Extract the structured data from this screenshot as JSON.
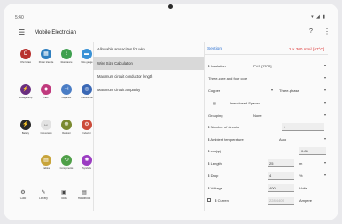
{
  "status": {
    "time": "5:40",
    "icons": "▾ ◢ ▮"
  },
  "app": {
    "title": "Mobile Electrician",
    "menu_icon": "☰",
    "help_icon": "?",
    "more_icon": "⋮"
  },
  "tiles": [
    {
      "name": "tile-ohm",
      "label": "Ohm's law",
      "color": "#b8322f",
      "glyph": "Ω"
    },
    {
      "name": "tile-power",
      "label": "Power triangle",
      "color": "#2f7fbf",
      "glyph": "▦"
    },
    {
      "name": "tile-resistance",
      "label": "Resistance",
      "color": "#3fa04f",
      "glyph": "⌇"
    },
    {
      "name": "tile-wire-gauge",
      "label": "Wire gauge",
      "color": "#3a92d6",
      "glyph": "▬"
    },
    {
      "name": "tile-voltage-drop",
      "label": "Voltage drop",
      "color": "#6a2f80",
      "glyph": "⚡"
    },
    {
      "name": "tile-led",
      "label": "LED",
      "color": "#c03a7e",
      "glyph": "◆"
    },
    {
      "name": "tile-capacitor",
      "label": "Capacitor",
      "color": "#4a7dc5",
      "glyph": "⊣"
    },
    {
      "name": "tile-transformer",
      "label": "Transformer",
      "color": "#3a68b5",
      "glyph": "◎"
    },
    {
      "name": "tile-battery",
      "label": "Battery",
      "color": "#2a2a2a",
      "glyph": "⚡"
    },
    {
      "name": "tile-conversion",
      "label": "Conversion",
      "color": "#e2e2e2",
      "glyph": "↔"
    },
    {
      "name": "tile-resistor",
      "label": "Resistor",
      "color": "#7a8a30",
      "glyph": "☸"
    },
    {
      "name": "tile-inductor",
      "label": "Inductor",
      "color": "#cc4b3a",
      "glyph": "⚙"
    },
    {
      "name": "tile-cables",
      "label": "Cables",
      "color": "#c8a43a",
      "glyph": "▤"
    },
    {
      "name": "tile-components",
      "label": "Components",
      "color": "#4f9f48",
      "glyph": "⟲"
    },
    {
      "name": "tile-symbols",
      "label": "Symbols",
      "color": "#9b3cc2",
      "glyph": "✺"
    }
  ],
  "bottom_nav": [
    {
      "name": "nav-calc",
      "label": "Calc",
      "icon": "⚙"
    },
    {
      "name": "nav-library",
      "label": "Library",
      "icon": "✎"
    },
    {
      "name": "nav-tools",
      "label": "Tools",
      "icon": "▣"
    },
    {
      "name": "nav-handbook",
      "label": "Handbook",
      "icon": "▤"
    }
  ],
  "middle": [
    "Allowable ampacities for wire",
    "Wire Size Calculation",
    "Maximum circuit conductor length",
    "Maximum circuit ampacity"
  ],
  "right": {
    "section_label": "Section",
    "result": "2 × 300 mm² [67°C]",
    "insulation_label": "Insulation",
    "insulation_value": "PVC [70°C]",
    "cable_type": "Three-core and four core",
    "conductor": "Copper",
    "phase": "Three-phase",
    "spacing": "Unenclosed Spaced",
    "grouping_label": "Grouping",
    "grouping_value": "None",
    "circuits_label": "Number of circuits",
    "circuits_value": "1",
    "ambient_label": "Ambient temperature",
    "ambient_value": "Auto",
    "cos_label": "cos(φ)",
    "cos_value": "0.85",
    "length_label": "Length",
    "length_value": "25",
    "length_unit": "m",
    "drop_label": "Drop",
    "drop_value": "4",
    "drop_unit": "%",
    "voltage_label": "Voltage",
    "voltage_value": "400",
    "voltage_unit": "Volts",
    "current_label": "Current",
    "current_value": "228.4405",
    "current_unit": "Ampere"
  }
}
